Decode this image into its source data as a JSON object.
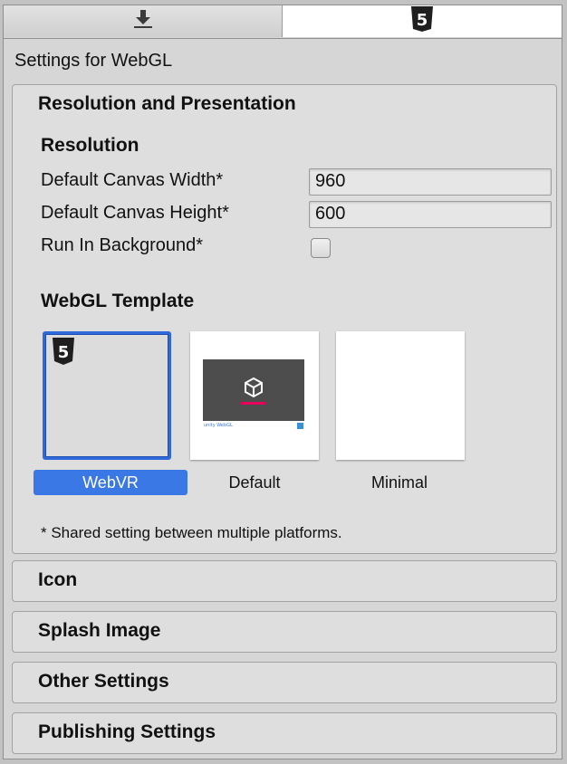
{
  "tabs": [
    {
      "icon": "download-icon",
      "active": false
    },
    {
      "icon": "html5-icon",
      "active": true
    }
  ],
  "settings_title": "Settings for WebGL",
  "resolution_section": {
    "header": "Resolution and Presentation",
    "resolution_subheader": "Resolution",
    "canvas_width_label": "Default Canvas Width*",
    "canvas_width_value": "960",
    "canvas_height_label": "Default Canvas Height*",
    "canvas_height_value": "600",
    "run_in_background_label": "Run In Background*",
    "run_in_background_checked": false,
    "template_subheader": "WebGL Template",
    "templates": [
      {
        "label": "WebVR",
        "selected": true
      },
      {
        "label": "Default",
        "selected": false
      },
      {
        "label": "Minimal",
        "selected": false
      }
    ],
    "default_thumb_brand": "unity WebGL",
    "shared_note": "* Shared setting between multiple platforms."
  },
  "sections": [
    {
      "header": "Icon"
    },
    {
      "header": "Splash Image"
    },
    {
      "header": "Other Settings"
    },
    {
      "header": "Publishing Settings"
    }
  ],
  "colors": {
    "selection_blue": "#3a78e6",
    "selection_border": "#2f68d8",
    "default_thumb_dark": "#4d4d4d",
    "unity_accent": "#e6005c"
  }
}
